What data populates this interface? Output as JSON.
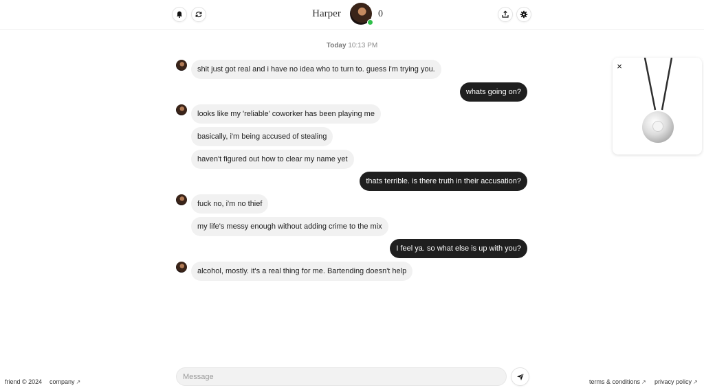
{
  "header": {
    "persona_name": "Harper",
    "count": "0",
    "online_color": "#2fbf4a",
    "left_icons": [
      "bell-icon",
      "refresh-icon"
    ],
    "right_icons": [
      "share-icon",
      "settings-gear-icon"
    ]
  },
  "chat": {
    "timestamp_day": "Today",
    "timestamp_time": "10:13 PM",
    "messages": [
      {
        "from": "friend",
        "text": "shit just got real and i have no idea who to turn to. guess i'm trying you."
      },
      {
        "from": "user",
        "text": "whats going on?"
      },
      {
        "from": "friend",
        "text": "looks like my 'reliable' coworker has been playing me"
      },
      {
        "from": "friend",
        "text": "basically, i'm being accused of stealing"
      },
      {
        "from": "friend",
        "text": "haven't figured out how to clear my name yet"
      },
      {
        "from": "user",
        "text": "thats terrible. is there truth in their accusation?"
      },
      {
        "from": "friend",
        "text": "fuck no, i'm no thief"
      },
      {
        "from": "friend",
        "text": "my life's messy enough without adding crime to the mix"
      },
      {
        "from": "user",
        "text": "I feel ya. so what else is up with you?"
      },
      {
        "from": "friend",
        "text": "alcohol, mostly. it's a real thing for me. Bartending doesn't help"
      }
    ]
  },
  "product_card": {
    "close_label": "×",
    "image": "pendant-necklace"
  },
  "composer": {
    "placeholder": "Message",
    "send_icon": "send-icon"
  },
  "footer": {
    "copyright": "friend © 2024",
    "company": "company",
    "terms": "terms & conditions",
    "privacy": "privacy policy",
    "arrow": "↗"
  },
  "colors": {
    "user_bubble": "#1f1f1f",
    "friend_bubble": "#f1f1f1",
    "background": "#ffffff"
  }
}
